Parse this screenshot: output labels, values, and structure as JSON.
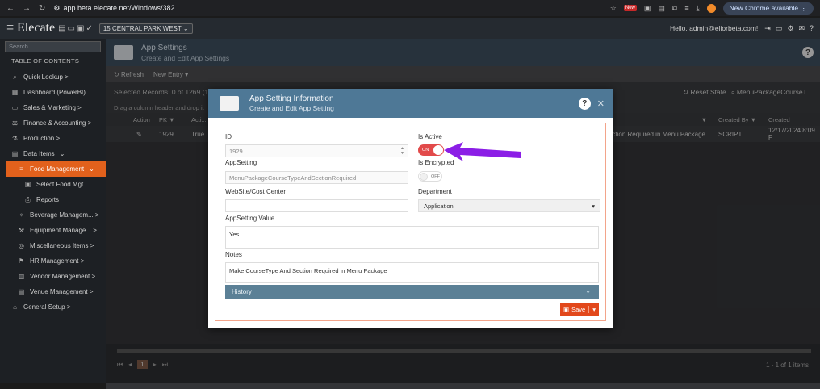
{
  "browser": {
    "url": "app.beta.elecate.net/Windows/382",
    "ext_badge": "New",
    "new_chrome": "New Chrome available"
  },
  "topbar": {
    "logo": "Elecate",
    "site": "15 CENTRAL PARK WEST",
    "hello": "Hello, admin@eliorbeta.com!"
  },
  "sidebar": {
    "search_placeholder": "Search...",
    "toc": "TABLE OF CONTENTS",
    "items": [
      {
        "label": "Quick Lookup >",
        "icon": "search-icon"
      },
      {
        "label": "Dashboard (PowerBI)",
        "icon": "dashboard-icon"
      },
      {
        "label": "Sales & Marketing >",
        "icon": "sales-icon"
      },
      {
        "label": "Finance & Accounting >",
        "icon": "finance-icon"
      },
      {
        "label": "Production >",
        "icon": "production-icon"
      },
      {
        "label": "Data Items",
        "icon": "data-icon"
      },
      {
        "label": "Food Management",
        "icon": "food-icon"
      },
      {
        "label": "Select Food Mgt",
        "icon": "select-icon"
      },
      {
        "label": "Reports",
        "icon": "reports-icon"
      },
      {
        "label": "Beverage Managem... >",
        "icon": "beverage-icon"
      },
      {
        "label": "Equipment Manage... >",
        "icon": "equipment-icon"
      },
      {
        "label": "Miscellaneous Items >",
        "icon": "misc-icon"
      },
      {
        "label": "HR Management >",
        "icon": "hr-icon"
      },
      {
        "label": "Vendor Management >",
        "icon": "vendor-icon"
      },
      {
        "label": "Venue Management >",
        "icon": "venue-icon"
      },
      {
        "label": "General Setup >",
        "icon": "setup-icon"
      }
    ]
  },
  "page": {
    "title": "App Settings",
    "subtitle": "Create and Edit App Settings",
    "refresh": "Refresh",
    "new_entry": "New Entry",
    "records": "Selected Records: 0 of 1269 (1",
    "reset_state": "Reset State",
    "filter_text": "MenuPackageCourseT...",
    "drag_hint": "Drag a column header and drop it",
    "columns": {
      "action": "Action",
      "pk": "PK",
      "active": "Acti...",
      "created_by": "Created By",
      "created": "Created"
    },
    "row": {
      "pk": "1929",
      "active": "True",
      "desc": "ction Required in Menu Package",
      "created_by": "SCRIPT",
      "created": "12/17/2024 8:09 F"
    },
    "pager_current": "1",
    "items_count": "1 - 1 of 1 items"
  },
  "modal": {
    "title": "App Setting Information",
    "subtitle": "Create and Edit App Setting",
    "id_label": "ID",
    "id_value": "1929",
    "is_active_label": "Is Active",
    "is_active_state": "ON",
    "appsetting_label": "AppSetting",
    "appsetting_value": "MenuPackageCourseTypeAndSectionRequired",
    "is_encrypted_label": "Is Encrypted",
    "is_encrypted_state": "OFF",
    "website_label": "WebSite/Cost Center",
    "website_value": "",
    "department_label": "Department",
    "department_value": "Application",
    "value_label": "AppSetting Value",
    "value_value": "Yes",
    "notes_label": "Notes",
    "notes_value": "Make CourseType And Section Required in Menu Package",
    "history": "History",
    "save": "Save"
  },
  "colors": {
    "accent": "#e2611c",
    "modal_header": "#4e7896",
    "toggle_on": "#e24a4a",
    "annotation_arrow": "#8b1ee6"
  }
}
